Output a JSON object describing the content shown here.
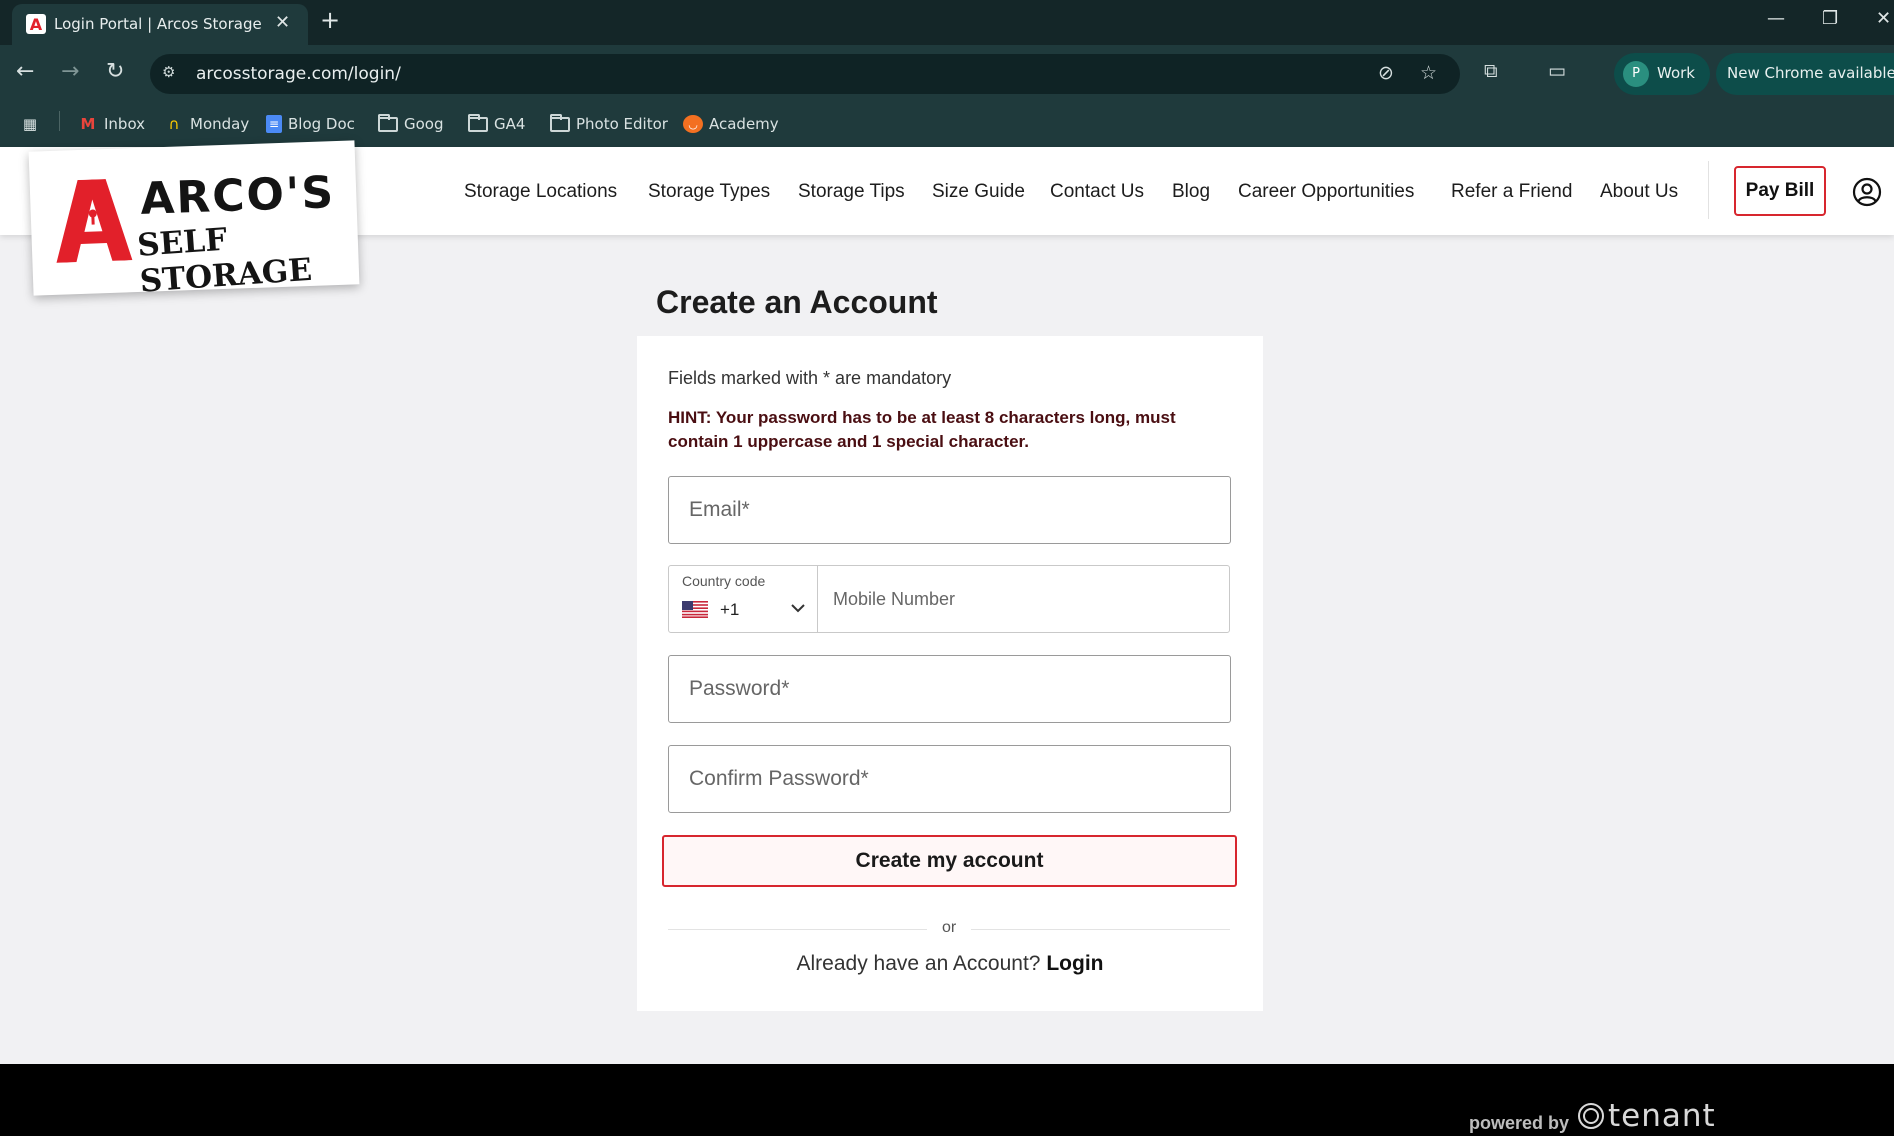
{
  "browser": {
    "tab_title": "Login Portal | Arcos Storage",
    "url": "arcosstorage.com/login/",
    "profile_label": "Work",
    "profile_initial": "P",
    "update_label": "New Chrome available",
    "bookmarks": [
      "Inbox",
      "Monday",
      "Blog Doc",
      "Goog",
      "GA4",
      "Photo Editor",
      "Academy"
    ]
  },
  "site": {
    "logo_line1": "ARCO'S",
    "logo_line2": "SELF STORAGE",
    "nav": [
      "Storage Locations",
      "Storage Types",
      "Storage Tips",
      "Size Guide",
      "Contact Us",
      "Blog",
      "Career Opportunities",
      "Refer a Friend",
      "About Us"
    ],
    "pay_bill": "Pay Bill",
    "brand_red": "#d7262e"
  },
  "form": {
    "title": "Create an Account",
    "mandatory_note": "Fields marked with * are mandatory",
    "hint": "HINT: Your password has to be at least 8 characters long, must contain 1 uppercase and 1 special character.",
    "email_placeholder": "Email*",
    "country_code_label": "Country code",
    "country_code_value": "+1",
    "mobile_placeholder": "Mobile Number",
    "password_placeholder": "Password*",
    "confirm_placeholder": "Confirm Password*",
    "submit_label": "Create my account",
    "or_label": "or",
    "already_text": "Already have an Account?",
    "login_link": "Login"
  },
  "footer": {
    "powered_by": "powered by",
    "brand": "tenant"
  }
}
